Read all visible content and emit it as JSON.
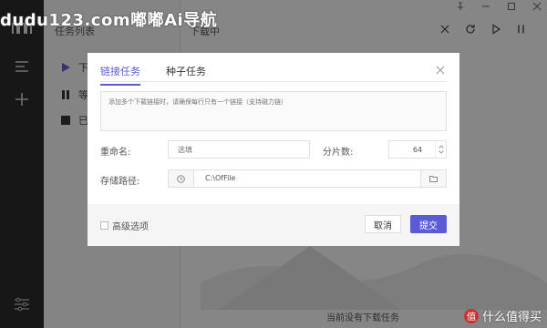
{
  "watermark_top": "dudu123.com嘟嘟Ai导航",
  "watermark_bottom": "什么值得买",
  "watermark_badge": "值",
  "tasklist": {
    "title": "任务列表",
    "items": [
      {
        "label": "下",
        "icon": "play-icon"
      },
      {
        "label": "等",
        "icon": "pause-icon"
      },
      {
        "label": "已",
        "icon": "stop-square-icon"
      }
    ]
  },
  "main": {
    "header": "下载中",
    "empty_text": "当前没有下载任务"
  },
  "modal": {
    "tabs": [
      {
        "label": "链接任务",
        "active": true
      },
      {
        "label": "种子任务",
        "active": false
      }
    ],
    "links_placeholder": "添加多个下载链接时，请确保每行只有一个链接（支持磁力链）",
    "rename_label": "重命名:",
    "rename_placeholder": "选填",
    "parts_label": "分片数:",
    "parts_value": "64",
    "path_label": "存储路径:",
    "path_value": "C:\\OfFile",
    "advanced_label": "高级选项",
    "cancel_label": "取消",
    "submit_label": "提交"
  },
  "colors": {
    "accent": "#5b5bd6",
    "rail": "#2b2b2b"
  }
}
